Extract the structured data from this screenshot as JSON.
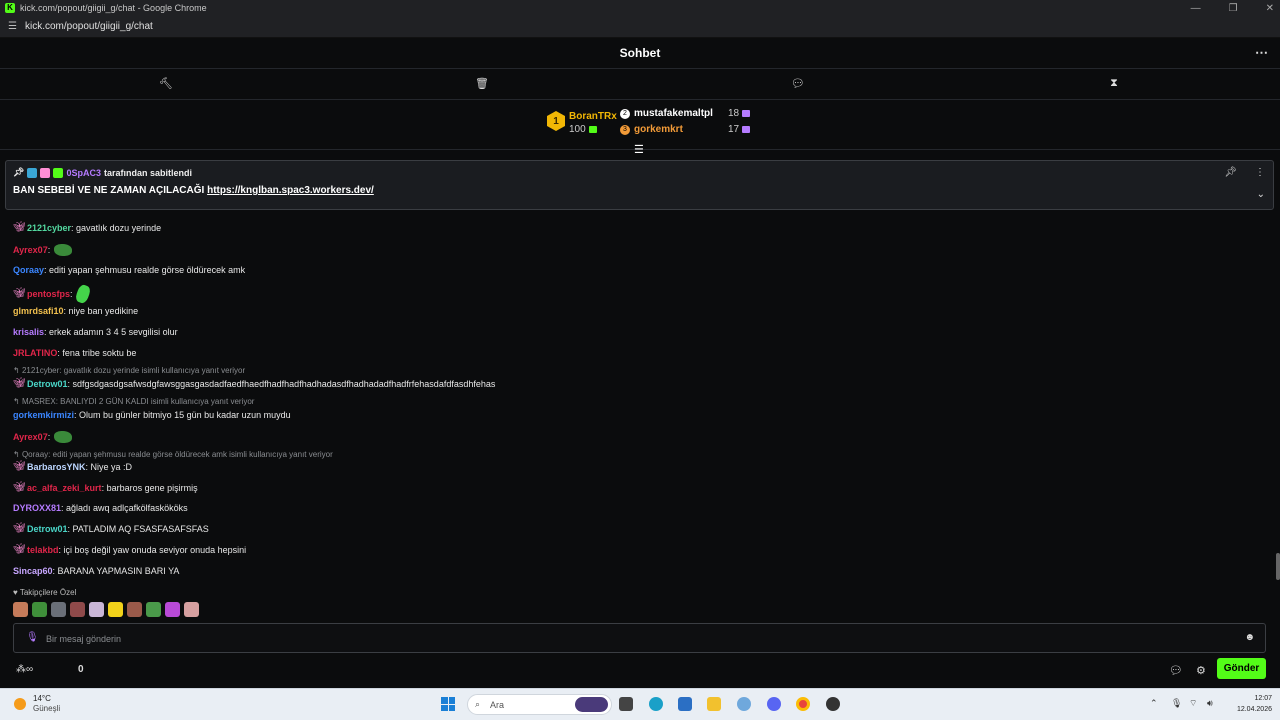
{
  "window": {
    "title": "kick.com/popout/giigii_g/chat - Google Chrome",
    "url": "kick.com/popout/giigii_g/chat"
  },
  "header": {
    "title": "Sohbet"
  },
  "leaderboard": {
    "first": {
      "rank": "1",
      "name": "BoranTRx",
      "points": "100"
    },
    "others": [
      {
        "name": "mustafakemaltpl",
        "count": "18",
        "color": "#ffffff"
      },
      {
        "name": "gorkemkrt",
        "count": "17",
        "color": "#f29b38"
      }
    ]
  },
  "pinned": {
    "pinned_by_user": "0SpAC3",
    "pinned_by_text": "tarafından sabitlendi",
    "message_prefix": "BAN SEBEBİ VE NE ZAMAN AÇILACAĞI",
    "link": "https://knglban.spac3.workers.dev/"
  },
  "messages": [
    {
      "user": "2121cyber",
      "text": ": gavatlık dozu yerinde",
      "color": "#53d9a0",
      "badge": true,
      "emote": ""
    },
    {
      "user": "Ayrex07",
      "text": ":",
      "color": "#e0264a",
      "badge": false,
      "emote": "frog"
    },
    {
      "user": "Qoraay",
      "text": ": editi yapan şehmusu realde görse öldürecek amk",
      "color": "#3b86ff",
      "badge": false,
      "emote": ""
    },
    {
      "user": "pentosfps",
      "text": ":",
      "color": "#e0264a",
      "badge": true,
      "emote": "green"
    },
    {
      "user": "glmrdsafi10",
      "text": ": niye ban yedikine",
      "color": "#f2c14e",
      "badge": false,
      "emote": ""
    },
    {
      "user": "krisalis",
      "text": ": erkek adamın 3 4 5 sevgilisi olur",
      "color": "#b57bff",
      "badge": false,
      "emote": ""
    },
    {
      "user": "JRLATINO",
      "text": ": fena tribe soktu be",
      "color": "#e0264a",
      "badge": false,
      "emote": ""
    },
    {
      "reply": "2121cyber: gavatlık dozu yerinde isimli kullanıcıya yanıt veriyor"
    },
    {
      "user": "Detrow01",
      "text": ": sdfgsdgasdgsafwsdgfawsggasgasdadfaedfhaedfhadfhadfhadhadasdfhadhadadfhadfrfehasdafdfasdhfehas",
      "color": "#4ad6c8",
      "badge": true,
      "emote": ""
    },
    {
      "reply": "MASREX: BANLIYDI 2 GÜN KALDI isimli kullanıcıya yanıt veriyor"
    },
    {
      "user": "gorkemkirmizi",
      "text": ": Olum bu günler bitmiyo 15 gün bu kadar uzun muydu",
      "color": "#3b86ff",
      "badge": false,
      "emote": ""
    },
    {
      "user": "Ayrex07",
      "text": ":",
      "color": "#e0264a",
      "badge": false,
      "emote": "frog"
    },
    {
      "reply": "Qoraay: editi yapan şehmusu realde görse öldürecek amk isimli kullanıcıya yanıt veriyor"
    },
    {
      "user": "BarbarosYNK",
      "text": ": Niye ya :D",
      "color": "#bcd6ff",
      "badge": true,
      "emote": ""
    },
    {
      "user": "ac_alfa_zeki_kurt",
      "text": ": barbaros gene pişirmiş",
      "color": "#e0264a",
      "badge": true,
      "emote": ""
    },
    {
      "user": "DYROXX81",
      "text": ": ağladı awq adlçafkölfaskököks",
      "color": "#b57bff",
      "badge": false,
      "emote": ""
    },
    {
      "user": "Detrow01",
      "text": ": PATLADIM AQ FSASFASAFSFAS",
      "color": "#4ad6c8",
      "badge": true,
      "emote": ""
    },
    {
      "user": "telakbd",
      "text": ": içi boş değil yaw onuda seviyor onuda hepsini",
      "color": "#e0264a",
      "badge": true,
      "emote": ""
    },
    {
      "user": "Sincap60",
      "text": ": BARANA YAPMASIN BARI YA",
      "color": "#c7a6ff",
      "badge": false,
      "emote": ""
    }
  ],
  "followers_only": "Takipçilere Özel",
  "input": {
    "placeholder": "Bir mesaj gönderin"
  },
  "bottom": {
    "points": "0",
    "send_label": "Gönder"
  },
  "taskbar": {
    "weather_temp": "14°C",
    "weather_desc": "Güneşli",
    "search_label": "Ara",
    "time": "12:07",
    "date": "12.04.2026"
  }
}
